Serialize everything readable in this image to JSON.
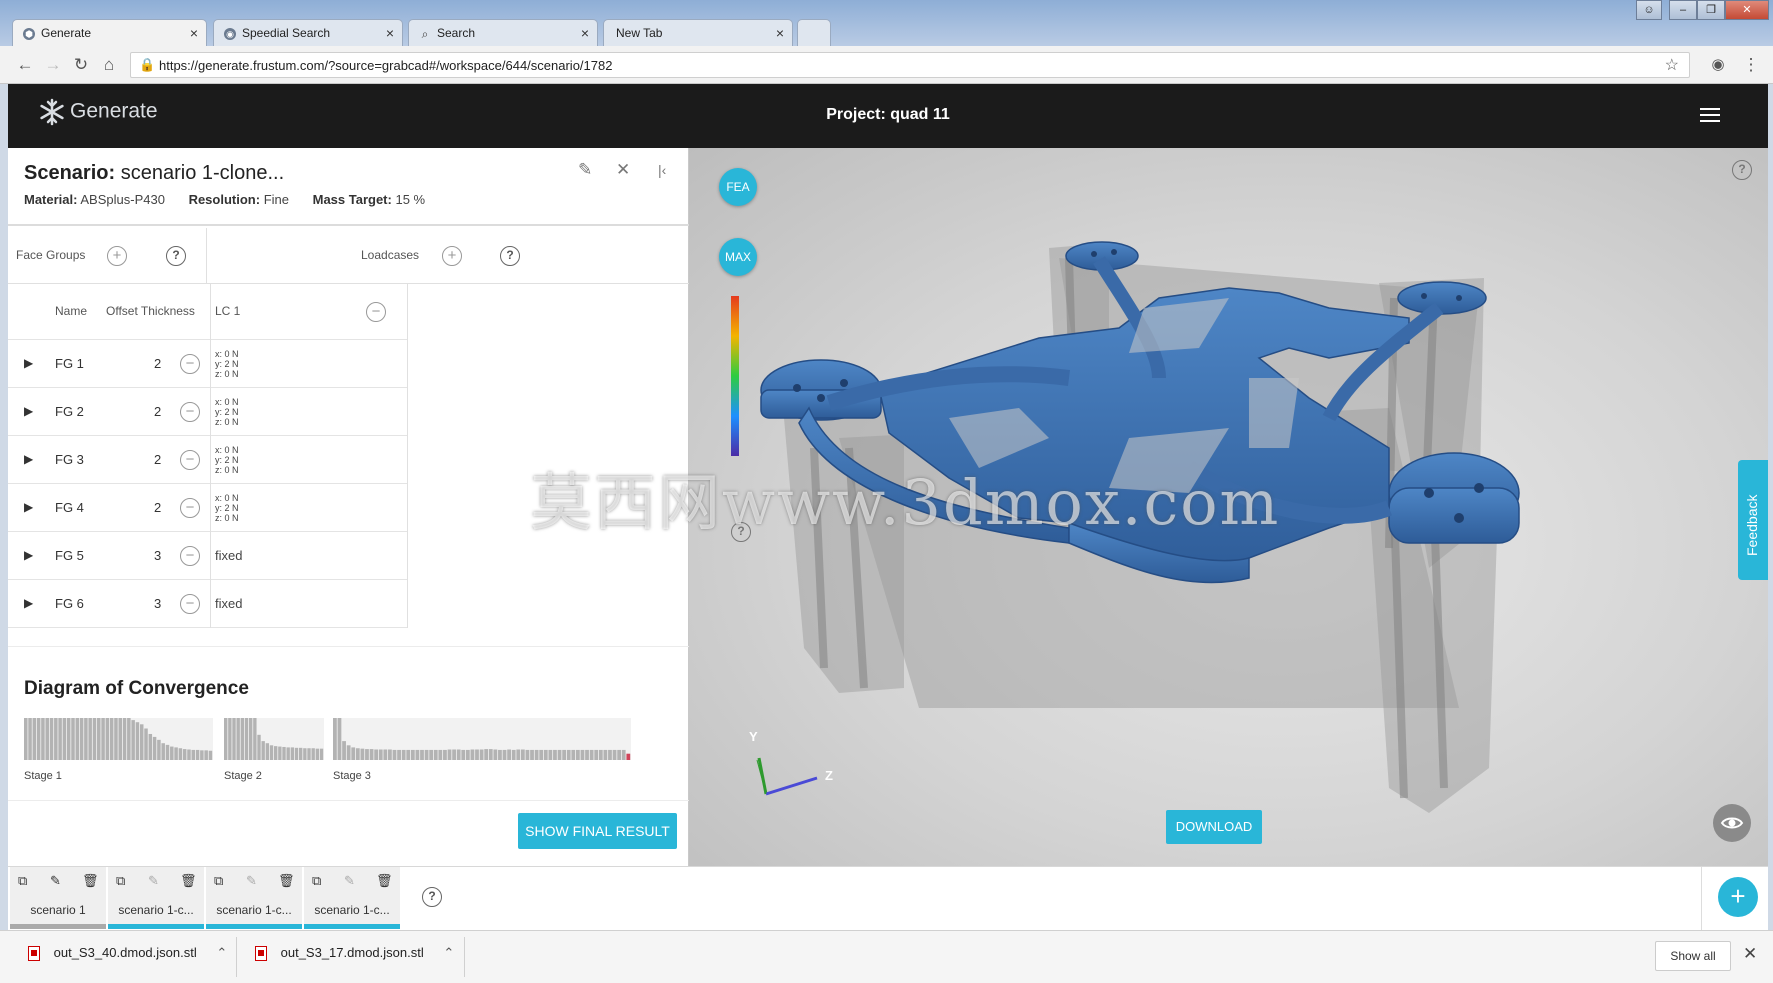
{
  "browser": {
    "tabs": [
      {
        "label": "Generate",
        "icon": "generate-favicon"
      },
      {
        "label": "Speedial Search",
        "icon": "speeddial-favicon"
      },
      {
        "label": "Search",
        "icon": "search-icon"
      },
      {
        "label": "New Tab",
        "icon": ""
      }
    ],
    "url": "https://generate.frustum.com/?source=grabcad#/workspace/644/scenario/1782"
  },
  "app": {
    "logo_text": "Generate",
    "project_title": "Project: quad 11"
  },
  "scenario": {
    "title_label": "Scenario:",
    "title_value": "scenario 1-clone...",
    "material_label": "Material:",
    "material_value": "ABSplus-P430",
    "resolution_label": "Resolution:",
    "resolution_value": "Fine",
    "mass_label": "Mass Target:",
    "mass_value": "15 %"
  },
  "groups_bar": {
    "face_groups_label": "Face Groups",
    "loadcases_label": "Loadcases"
  },
  "table": {
    "headers": {
      "name": "Name",
      "offset": "Offset Thickness",
      "lc": "LC 1"
    },
    "rows": [
      {
        "name": "FG 1",
        "offset": "2",
        "load": [
          "x: 0 N",
          "y: 2 N",
          "z: 0 N"
        ]
      },
      {
        "name": "FG 2",
        "offset": "2",
        "load": [
          "x: 0 N",
          "y: 2 N",
          "z: 0 N"
        ]
      },
      {
        "name": "FG 3",
        "offset": "2",
        "load": [
          "x: 0 N",
          "y: 2 N",
          "z: 0 N"
        ]
      },
      {
        "name": "FG 4",
        "offset": "2",
        "load": [
          "x: 0 N",
          "y: 2 N",
          "z: 0 N"
        ]
      },
      {
        "name": "FG 5",
        "offset": "3",
        "load": [
          "fixed"
        ]
      },
      {
        "name": "FG 6",
        "offset": "3",
        "load": [
          "fixed"
        ]
      }
    ]
  },
  "convergence": {
    "title": "Diagram of Convergence",
    "stages": [
      {
        "label": "Stage 1",
        "values": [
          1,
          1,
          1,
          1,
          1,
          1,
          1,
          1,
          1,
          1,
          1,
          1,
          1,
          1,
          1,
          1,
          1,
          1,
          1,
          1,
          1,
          1,
          1,
          1,
          1,
          0.95,
          0.9,
          0.85,
          0.75,
          0.62,
          0.55,
          0.48,
          0.4,
          0.36,
          0.32,
          0.3,
          0.28,
          0.26,
          0.25,
          0.24,
          0.24,
          0.23,
          0.23,
          0.22
        ]
      },
      {
        "label": "Stage 2",
        "values": [
          1,
          1,
          1,
          1,
          1,
          1,
          1,
          1,
          0.6,
          0.45,
          0.4,
          0.35,
          0.33,
          0.32,
          0.31,
          0.3,
          0.3,
          0.29,
          0.29,
          0.28,
          0.28,
          0.28,
          0.27,
          0.27
        ]
      },
      {
        "label": "Stage 3",
        "values": [
          1,
          1,
          0.45,
          0.35,
          0.3,
          0.28,
          0.27,
          0.26,
          0.26,
          0.25,
          0.25,
          0.25,
          0.25,
          0.24,
          0.24,
          0.24,
          0.24,
          0.24,
          0.24,
          0.24,
          0.24,
          0.24,
          0.24,
          0.24,
          0.24,
          0.25,
          0.25,
          0.25,
          0.24,
          0.24,
          0.25,
          0.25,
          0.25,
          0.26,
          0.26,
          0.25,
          0.24,
          0.24,
          0.25,
          0.24,
          0.25,
          0.25,
          0.24,
          0.24,
          0.24,
          0.24,
          0.24,
          0.24,
          0.24,
          0.24,
          0.24,
          0.24,
          0.24,
          0.24,
          0.24,
          0.24,
          0.24,
          0.24,
          0.24,
          0.24,
          0.24,
          0.24,
          0.24,
          0.24,
          0.15
        ]
      }
    ],
    "bar_color": "#b3b3b3",
    "last_bar_color": "#d0455b"
  },
  "buttons": {
    "show_final": "SHOW FINAL RESULT",
    "fea": "FEA",
    "max": "MAX",
    "download": "DOWNLOAD",
    "feedback": "Feedback"
  },
  "viewport": {
    "axis_y": "Y",
    "axis_z": "Z",
    "watermark": "莫西网www.3dmox.com"
  },
  "scenario_tabs": [
    {
      "label": "scenario 1",
      "active": false
    },
    {
      "label": "scenario 1-c...",
      "active": true
    },
    {
      "label": "scenario 1-c...",
      "active": true
    },
    {
      "label": "scenario 1-c...",
      "active": true
    }
  ],
  "downloads": {
    "files": [
      "out_S3_40.dmod.json.stl",
      "out_S3_17.dmod.json.stl"
    ],
    "show_all": "Show all"
  },
  "colors": {
    "accent": "#29b6d8",
    "header_bg": "#1b1b1b",
    "part_blue": "#3a6aa8"
  }
}
